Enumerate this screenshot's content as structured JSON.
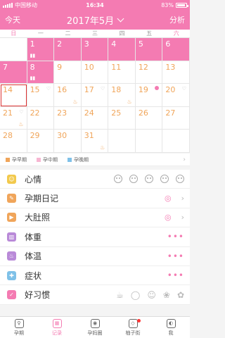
{
  "status": {
    "carrier": "中国移动",
    "time": "16:34",
    "battery": "83%"
  },
  "header": {
    "today": "今天",
    "title": "2017年5月",
    "analysis": "分析"
  },
  "weekdays": [
    "日",
    "一",
    "二",
    "三",
    "四",
    "五",
    "六"
  ],
  "days": [
    {
      "n": "",
      "t": "empty"
    },
    {
      "n": "1",
      "t": "period",
      "mark": "drop"
    },
    {
      "n": "2",
      "t": "period"
    },
    {
      "n": "3",
      "t": "period"
    },
    {
      "n": "4",
      "t": "period"
    },
    {
      "n": "5",
      "t": "period"
    },
    {
      "n": "6",
      "t": "period"
    },
    {
      "n": "7",
      "t": "period"
    },
    {
      "n": "8",
      "t": "period",
      "mark": "drop"
    },
    {
      "n": "9",
      "t": "normal"
    },
    {
      "n": "10",
      "t": "normal"
    },
    {
      "n": "11",
      "t": "normal"
    },
    {
      "n": "12",
      "t": "normal"
    },
    {
      "n": "13",
      "t": "normal"
    },
    {
      "n": "14",
      "t": "normal",
      "selected": true
    },
    {
      "n": "15",
      "t": "normal",
      "heart": true
    },
    {
      "n": "16",
      "t": "normal",
      "fire": true
    },
    {
      "n": "17",
      "t": "normal",
      "heart": true
    },
    {
      "n": "18",
      "t": "normal",
      "fire": true
    },
    {
      "n": "19",
      "t": "normal",
      "rec": true
    },
    {
      "n": "20",
      "t": "normal",
      "heart": true
    },
    {
      "n": "21",
      "t": "normal",
      "heart": true,
      "fire": true
    },
    {
      "n": "22",
      "t": "normal"
    },
    {
      "n": "23",
      "t": "normal"
    },
    {
      "n": "24",
      "t": "normal"
    },
    {
      "n": "25",
      "t": "normal"
    },
    {
      "n": "26",
      "t": "normal"
    },
    {
      "n": "27",
      "t": "normal"
    },
    {
      "n": "28",
      "t": "normal"
    },
    {
      "n": "29",
      "t": "normal"
    },
    {
      "n": "30",
      "t": "normal"
    },
    {
      "n": "31",
      "t": "normal",
      "fire": true
    },
    {
      "n": "",
      "t": "empty"
    },
    {
      "n": "",
      "t": "empty"
    },
    {
      "n": "",
      "t": "empty"
    }
  ],
  "legend": [
    {
      "label": "孕早期",
      "color": "#f0a55a"
    },
    {
      "label": "孕中期",
      "color": "#f7b6d2"
    },
    {
      "label": "孕晚期",
      "color": "#7fc1e8"
    }
  ],
  "rows": [
    {
      "label": "心情",
      "icon": "smile-icon",
      "color": "#f2c94c",
      "kind": "faces"
    },
    {
      "label": "孕期日记",
      "icon": "diary-icon",
      "color": "#f0a55a",
      "kind": "camera"
    },
    {
      "label": "大肚照",
      "icon": "video-icon",
      "color": "#f0a55a",
      "kind": "camera"
    },
    {
      "label": "体重",
      "icon": "scale-icon",
      "color": "#b98ad8",
      "kind": "dots"
    },
    {
      "label": "体温",
      "icon": "thermometer-icon",
      "color": "#b98ad8",
      "kind": "dots"
    },
    {
      "label": "症状",
      "icon": "medical-kit-icon",
      "color": "#7fc1e8",
      "kind": "dots"
    },
    {
      "label": "好习惯",
      "icon": "thumb-up-icon",
      "color": "#f47bb2",
      "kind": "habits"
    }
  ],
  "tabs": [
    {
      "label": "孕期",
      "icon": "pregnancy-icon"
    },
    {
      "label": "记录",
      "icon": "calendar-icon",
      "active": true
    },
    {
      "label": "孕妈圈",
      "icon": "community-icon"
    },
    {
      "label": "柚子街",
      "icon": "shop-icon",
      "badge": true
    },
    {
      "label": "我",
      "icon": "profile-icon"
    }
  ]
}
